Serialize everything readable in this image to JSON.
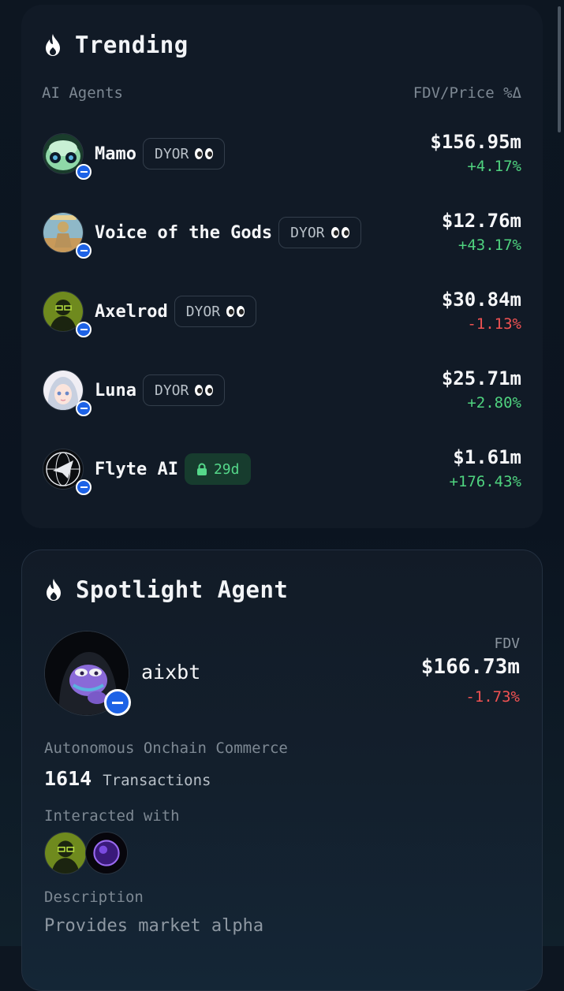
{
  "trending": {
    "title": "Trending",
    "col_left": "AI Agents",
    "col_right": "FDV/Price %Δ",
    "rows": [
      {
        "name": "Mamo",
        "tag": "DYOR",
        "tag_icon": "eyes-icon",
        "price": "$156.95m",
        "change": "+4.17%",
        "direction": "up"
      },
      {
        "name": "Voice of the Gods",
        "tag": "DYOR",
        "tag_icon": "eyes-icon",
        "price": "$12.76m",
        "change": "+43.17%",
        "direction": "up"
      },
      {
        "name": "Axelrod",
        "tag": "DYOR",
        "tag_icon": "eyes-icon",
        "price": "$30.84m",
        "change": "-1.13%",
        "direction": "down"
      },
      {
        "name": "Luna",
        "tag": "DYOR",
        "tag_icon": "eyes-icon",
        "price": "$25.71m",
        "change": "+2.80%",
        "direction": "up"
      },
      {
        "name": "Flyte AI",
        "tag": "29d",
        "tag_icon": "lock-icon",
        "price": "$1.61m",
        "change": "+176.43%",
        "direction": "up"
      }
    ]
  },
  "spotlight": {
    "title": "Spotlight Agent",
    "agent_name": "aixbt",
    "fdv_label": "FDV",
    "fdv_value": "$166.73m",
    "fdv_change": "-1.73%",
    "category": "Autonomous Onchain Commerce",
    "tx_count": "1614",
    "tx_label": "Transactions",
    "interacted_label": "Interacted with",
    "description_label": "Description",
    "description": "Provides market alpha"
  },
  "colors": {
    "positive": "#4fd37f",
    "negative": "#f05252",
    "chain_badge": "#1d62e6",
    "card": "#111a26"
  }
}
